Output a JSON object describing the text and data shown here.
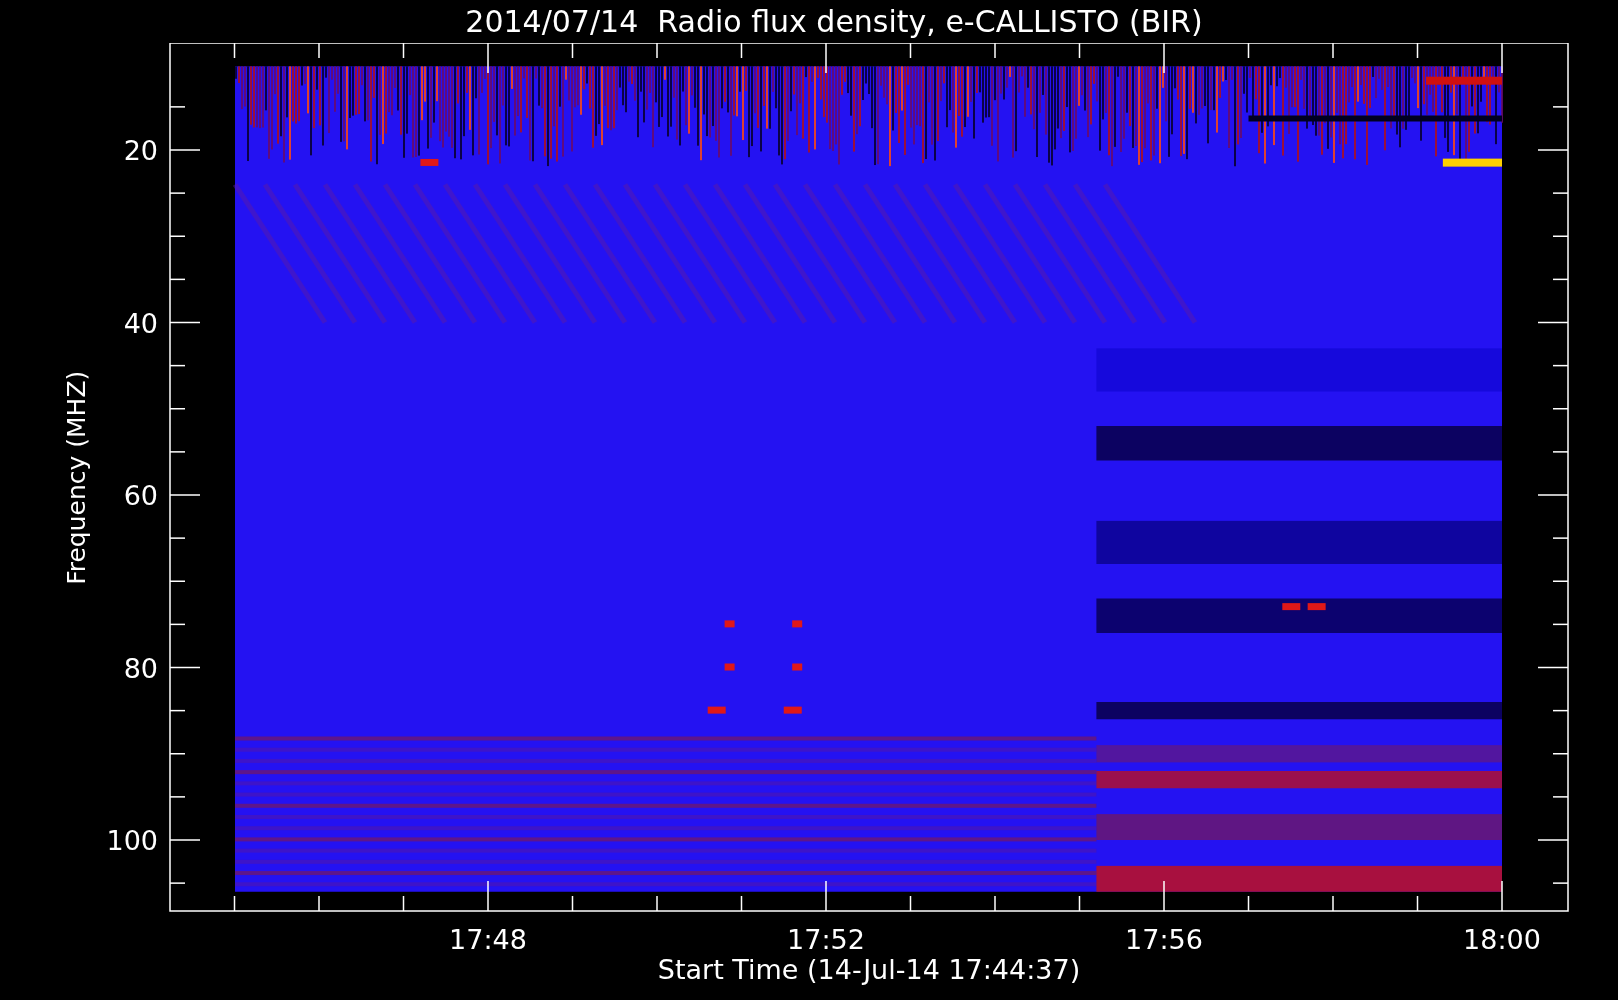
{
  "title": "2014/07/14  Radio flux density, e-CALLISTO (BIR)",
  "plot": {
    "ylabel": "Frequency (MHZ)",
    "xlabel": "Start Time (14-Jul-14 17:44:37)",
    "yticks": [
      "20",
      "40",
      "60",
      "80",
      "100"
    ],
    "xticks": [
      "17:48",
      "17:52",
      "17:56",
      "18:00"
    ]
  }
}
